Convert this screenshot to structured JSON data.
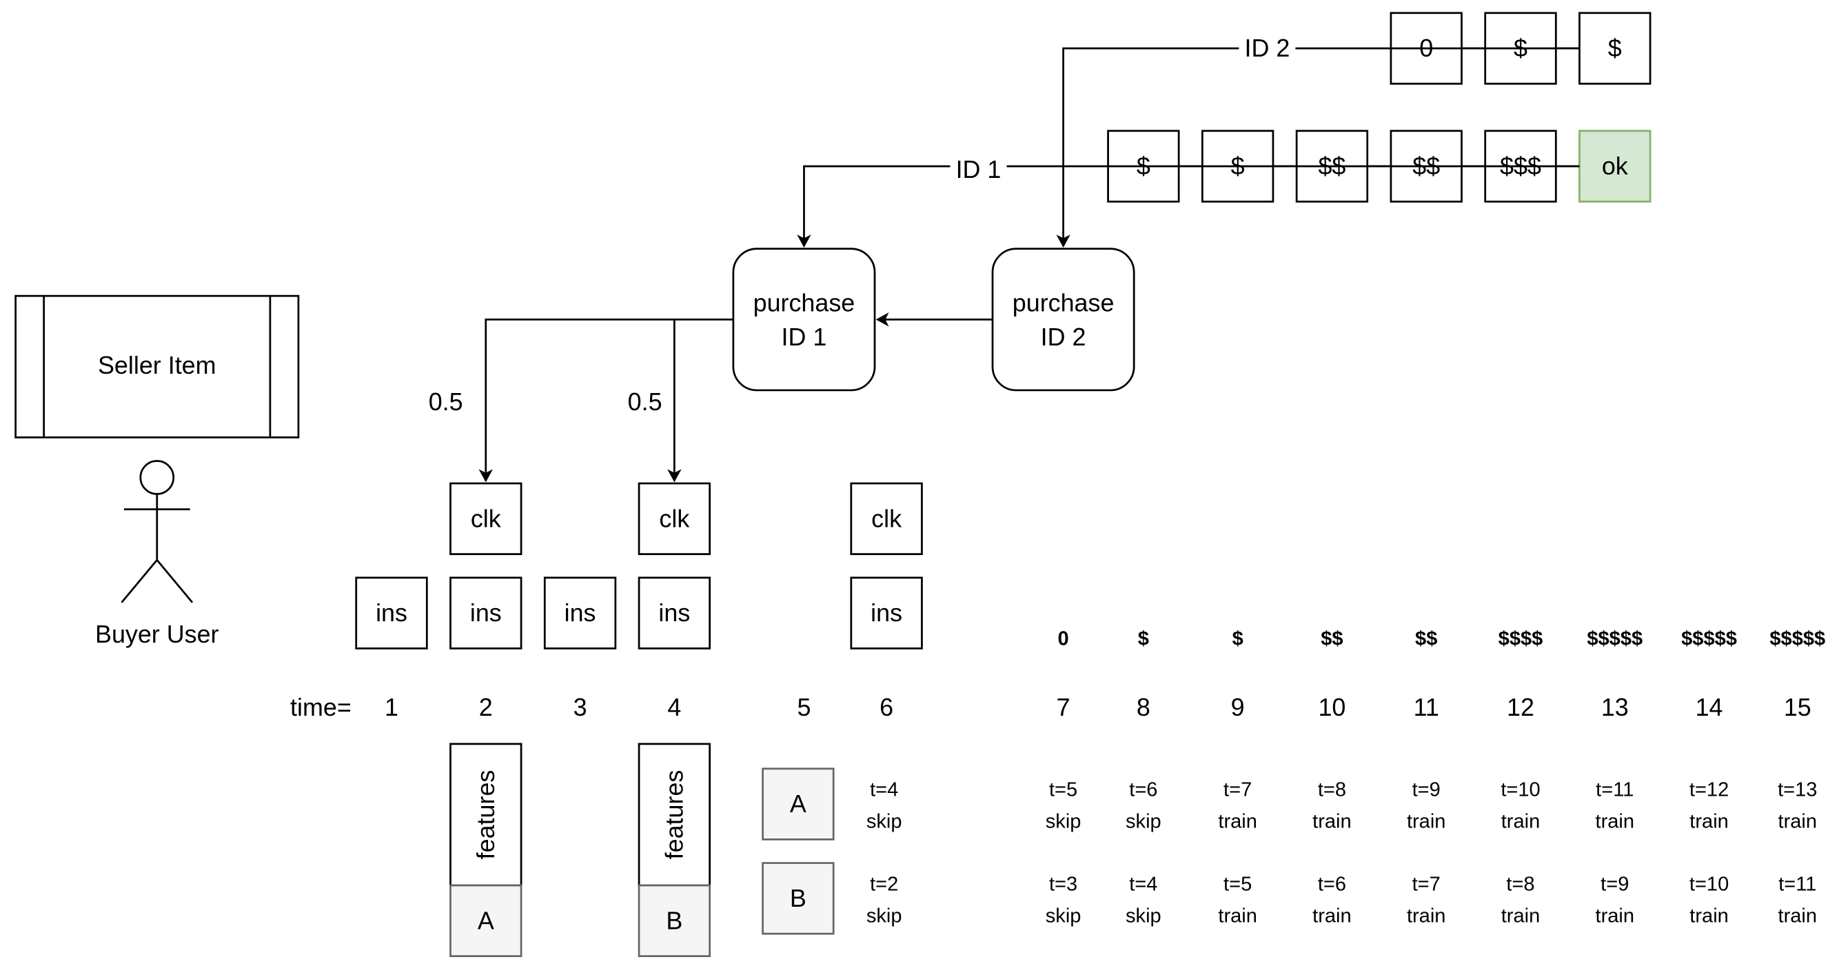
{
  "colors": {
    "ok_fill": "#d5e8d4",
    "ok_stroke": "#82b366",
    "gray_fill": "#f5f5f5",
    "gray_stroke": "#666666"
  },
  "seller_item": "Seller Item",
  "buyer_user": "Buyer User",
  "purchase_id1": [
    "purchase",
    "ID 1"
  ],
  "purchase_id2": [
    "purchase",
    "ID 2"
  ],
  "edge_labels": {
    "id1": "ID 1",
    "id2": "ID 2",
    "split_left": "0.5",
    "split_right": "0.5"
  },
  "id2_sequence": [
    "0",
    "$",
    "$"
  ],
  "id1_sequence": [
    "$",
    "$",
    "$$",
    "$$",
    "$$$",
    "ok"
  ],
  "clk_label": "clk",
  "ins_label": "ins",
  "time_prefix": "time=",
  "timeline": [
    {
      "t": "1",
      "ins": true,
      "clk": false
    },
    {
      "t": "2",
      "ins": true,
      "clk": true
    },
    {
      "t": "3",
      "ins": true,
      "clk": false
    },
    {
      "t": "4",
      "ins": true,
      "clk": true
    },
    {
      "t": "5",
      "ins": false,
      "clk": false
    },
    {
      "t": "6",
      "ins": true,
      "clk": true
    }
  ],
  "features_label": "features",
  "features_items": [
    "A",
    "B"
  ],
  "pending": [
    {
      "item": "A",
      "t": "t=4",
      "action": "skip"
    },
    {
      "item": "B",
      "t": "t=2",
      "action": "skip"
    }
  ],
  "later": [
    {
      "time": "7",
      "value": "0",
      "a": [
        "t=5",
        "skip"
      ],
      "b": [
        "t=3",
        "skip"
      ]
    },
    {
      "time": "8",
      "value": "$",
      "a": [
        "t=6",
        "skip"
      ],
      "b": [
        "t=4",
        "skip"
      ]
    },
    {
      "time": "9",
      "value": "$",
      "a": [
        "t=7",
        "train"
      ],
      "b": [
        "t=5",
        "train"
      ]
    },
    {
      "time": "10",
      "value": "$$",
      "a": [
        "t=8",
        "train"
      ],
      "b": [
        "t=6",
        "train"
      ]
    },
    {
      "time": "11",
      "value": "$$",
      "a": [
        "t=9",
        "train"
      ],
      "b": [
        "t=7",
        "train"
      ]
    },
    {
      "time": "12",
      "value": "$$$$",
      "a": [
        "t=10",
        "train"
      ],
      "b": [
        "t=8",
        "train"
      ]
    },
    {
      "time": "13",
      "value": "$$$$$",
      "a": [
        "t=11",
        "train"
      ],
      "b": [
        "t=9",
        "train"
      ]
    },
    {
      "time": "14",
      "value": "$$$$$",
      "a": [
        "t=12",
        "train"
      ],
      "b": [
        "t=10",
        "train"
      ]
    },
    {
      "time": "15",
      "value": "$$$$$",
      "a": [
        "t=13",
        "train"
      ],
      "b": [
        "t=11",
        "train"
      ]
    }
  ]
}
